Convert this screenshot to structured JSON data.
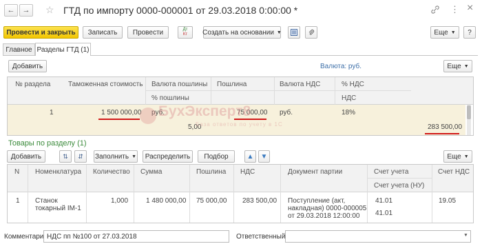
{
  "window": {
    "title": "ГТД по импорту 0000-000001 от 29.03.2018 0:00:00 *",
    "back_icon": "←",
    "forward_icon": "→",
    "star_icon": "☆",
    "link_icon": "🔗",
    "more_icon": "⋮",
    "close_icon": "×"
  },
  "toolbar": {
    "post_close": "Провести и закрыть",
    "save": "Записать",
    "post": "Провести",
    "dtkt_label_top": "Дт",
    "dtkt_label_bottom": "Кт",
    "create_based": "Создать на основании",
    "more": "Еще",
    "help": "?"
  },
  "tabs": [
    {
      "label": "Главное"
    },
    {
      "label": "Разделы ГТД (1)"
    }
  ],
  "sections": {
    "add_button": "Добавить",
    "currency_label": "Валюта: руб.",
    "more": "Еще",
    "columns": {
      "num": "№ раздела",
      "customs_value": "Таможенная стоимость",
      "duty_currency": "Валюта пошлины",
      "duty_percent": "% пошлины",
      "duty": "Пошлина",
      "vat_currency": "Валюта НДС",
      "vat_percent_top": "% НДС",
      "vat_percent_bottom": "НДС"
    },
    "row": {
      "num": "1",
      "customs_value": "1 500 000,00",
      "duty_currency": "руб.",
      "duty_percent": "5,00",
      "duty": "75 000,00",
      "vat_currency": "руб.",
      "vat_percent": "18%",
      "vat": "283 500,00"
    }
  },
  "watermark": {
    "big": "БухЭксперт8",
    "small": "База ответов по учету в 1С"
  },
  "goods": {
    "title": "Товары по разделу (1)",
    "add": "Добавить",
    "fill": "Заполнить",
    "distribute": "Распределить",
    "select": "Подбор",
    "more": "Еще",
    "columns": {
      "n": "N",
      "nomenclature": "Номенклатура",
      "qty": "Количество",
      "sum": "Сумма",
      "duty": "Пошлина",
      "vat": "НДС",
      "batch_doc": "Документ партии",
      "account_top": "Счет учета",
      "account_bottom": "Счет учета (НУ)",
      "vat_account": "Счет НДС"
    },
    "row": {
      "n": "1",
      "nomenclature_1": "Станок",
      "nomenclature_2": "токарный IM-1",
      "qty": "1,000",
      "sum": "1 480 000,00",
      "duty": "75 000,00",
      "vat": "283 500,00",
      "batch_1": "Поступление (акт,",
      "batch_2": "накладная) 0000-000005",
      "batch_3": "от 29.03.2018 12:00:00",
      "account": "41.01",
      "account_nu": "41.01",
      "vat_account": "19.05"
    }
  },
  "footer": {
    "comment_label": "Комментарий:",
    "comment_value": "НДС пп №100 от 27.03.2018",
    "responsible_label": "Ответственный:",
    "responsible_value": ""
  }
}
